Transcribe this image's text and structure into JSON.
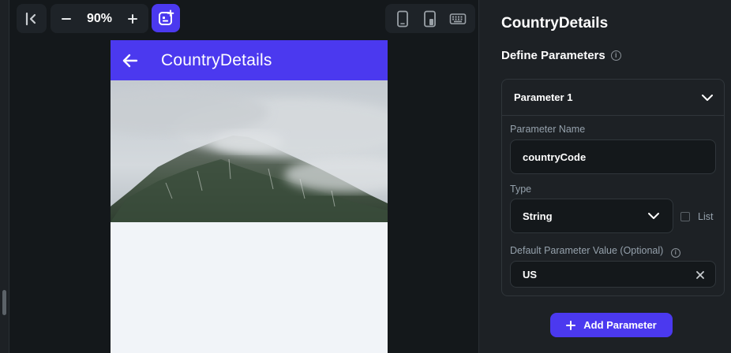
{
  "toolbar": {
    "zoom_minus": "−",
    "zoom_value": "90%",
    "zoom_plus": "+"
  },
  "preview": {
    "appbar_title": "CountryDetails",
    "colors": {
      "appbar": "#4b39ef",
      "background": "#f1f4f8"
    }
  },
  "panel": {
    "title": "CountryDetails",
    "section_title": "Define Parameters",
    "info_glyph": "i",
    "parameter": {
      "header": "Parameter 1",
      "name_label": "Parameter Name",
      "name_value": "countryCode",
      "type_label": "Type",
      "type_value": "String",
      "list_label": "List",
      "list_checked": false,
      "default_label": "Default Parameter Value (Optional)",
      "default_value": "US"
    },
    "add_button": "Add Parameter"
  },
  "colors": {
    "accent": "#4b39ef",
    "panel_bg": "#1d2125",
    "canvas_bg": "#14181b",
    "secondary_text": "#95a1ac"
  }
}
